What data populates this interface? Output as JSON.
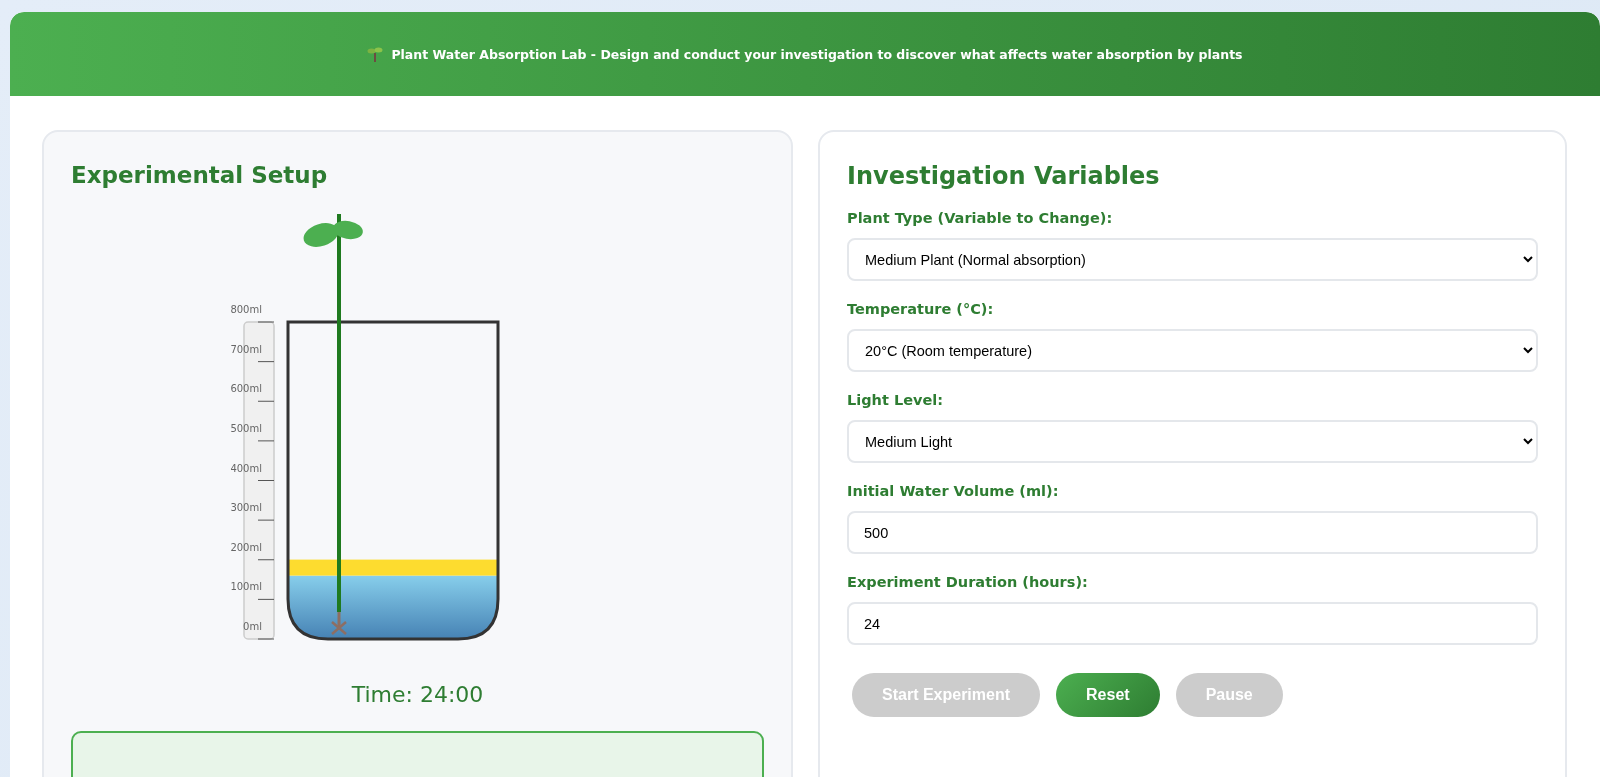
{
  "header": {
    "title": "Plant Water Absorption Lab - Design and conduct your investigation to discover what affects water absorption by plants"
  },
  "setup": {
    "title": "Experimental Setup",
    "scale_labels": [
      "800ml",
      "700ml",
      "600ml",
      "500ml",
      "400ml",
      "300ml",
      "200ml",
      "100ml",
      "0ml"
    ],
    "water": {
      "level": 0.2
    },
    "time": "Time: 24:00"
  },
  "variables": {
    "title": "Investigation Variables",
    "fields": [
      {
        "kind": "select",
        "label": "Plant Type (Variable to Change):",
        "value": "Medium Plant (Normal absorption)"
      },
      {
        "kind": "select",
        "label": "Temperature (°C):",
        "value": "20°C (Room temperature)"
      },
      {
        "kind": "select",
        "label": "Light Level:",
        "value": "Medium Light"
      },
      {
        "kind": "input",
        "label": "Initial Water Volume (ml):",
        "value": "500"
      },
      {
        "kind": "input",
        "label": "Experiment Duration (hours):",
        "value": "24"
      }
    ],
    "buttons": [
      {
        "label": "Start Experiment",
        "disabled": true
      },
      {
        "label": "Reset",
        "disabled": false
      },
      {
        "label": "Pause",
        "disabled": true
      }
    ]
  }
}
